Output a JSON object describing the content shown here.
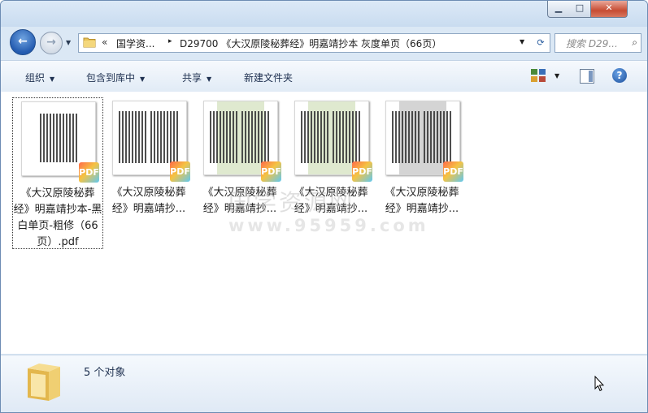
{
  "window": {
    "minimize_glyph": "▁",
    "maximize_glyph": "□",
    "close_glyph": "✕"
  },
  "nav": {
    "back_glyph": "←",
    "forward_glyph": "→",
    "dropdown_glyph": "▼",
    "address": {
      "overflow_glyph": "«",
      "segment1": "国学资...",
      "separator": "▸",
      "segment2": "D29700 《大汉原陵秘葬经》明嘉靖抄本 灰度单页（66页）"
    },
    "refresh_glyph": "⟳",
    "search_placeholder": "搜索 D29...",
    "search_icon": "search-icon"
  },
  "toolbar": {
    "organize_label": "组织",
    "include_label": "包含到库中",
    "share_label": "共享",
    "new_folder_label": "新建文件夹",
    "caret": "▼",
    "help_glyph": "?"
  },
  "files": [
    {
      "caption": "《大汉原陵秘葬经》明嘉靖抄本-黑白单页-粗修（66页）.pdf",
      "badge": "PDF",
      "selected": true,
      "thumb_bg": "#ffffff"
    },
    {
      "caption": "《大汉原陵秘葬经》明嘉靖抄...",
      "badge": "PDF",
      "selected": false,
      "thumb_bg": "#ffffff"
    },
    {
      "caption": "《大汉原陵秘葬经》明嘉靖抄...",
      "badge": "PDF",
      "selected": false,
      "thumb_bg": "#dfe9cf"
    },
    {
      "caption": "《大汉原陵秘葬经》明嘉靖抄...",
      "badge": "PDF",
      "selected": false,
      "thumb_bg": "#dfe9cf"
    },
    {
      "caption": "《大汉原陵秘葬经》明嘉靖抄...",
      "badge": "PDF",
      "selected": false,
      "thumb_bg": "#d4d4d4"
    }
  ],
  "watermark": {
    "text": "国学资源网",
    "url": "www.95959.com"
  },
  "details": {
    "count_text": "5 个对象"
  },
  "colors": {
    "window_frame": "#dbe8f5",
    "content_bg": "#ffffff",
    "selection_border": "#333333"
  }
}
